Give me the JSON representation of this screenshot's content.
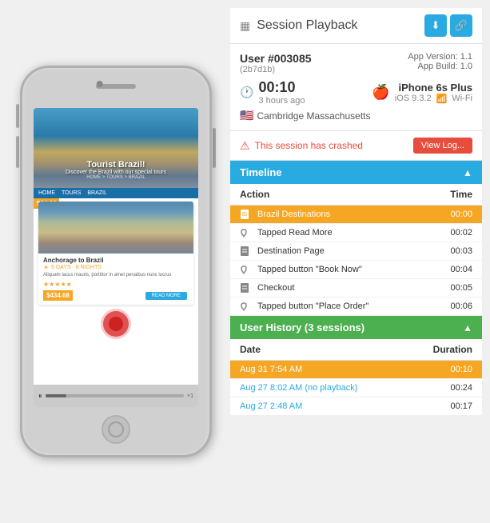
{
  "panel": {
    "title": "Session Playback",
    "download_label": "⬇",
    "share_label": "🔗"
  },
  "user": {
    "id": "User #003085",
    "sub_id": "(2b7d1b)",
    "app_version_label": "App Version: 1.1",
    "app_build_label": "App Build: 1.0",
    "duration": "00:10",
    "time_ago": "3 hours ago",
    "device_name": "iPhone 6s Plus",
    "ios_version": "iOS 9.3.2",
    "wifi": "Wi-Fi",
    "location": "Cambridge Massachusetts"
  },
  "crash": {
    "message": "This session has crashed",
    "view_log_label": "View Log..."
  },
  "timeline": {
    "title": "Timeline",
    "columns": {
      "action": "Action",
      "time": "Time"
    },
    "rows": [
      {
        "icon": "page",
        "action": "Brazil Destinations",
        "time": "00:00",
        "highlighted": true
      },
      {
        "icon": "tap",
        "action": "Tapped Read More",
        "time": "00:02",
        "highlighted": false
      },
      {
        "icon": "page",
        "action": "Destination Page",
        "time": "00:03",
        "highlighted": false
      },
      {
        "icon": "tap",
        "action": "Tapped button \"Book Now\"",
        "time": "00:04",
        "highlighted": false
      },
      {
        "icon": "page",
        "action": "Checkout",
        "time": "00:05",
        "highlighted": false
      },
      {
        "icon": "tap",
        "action": "Tapped button \"Place Order\"",
        "time": "00:06",
        "highlighted": false
      }
    ]
  },
  "user_history": {
    "title": "User History (3 sessions)",
    "columns": {
      "date": "Date",
      "duration": "Duration"
    },
    "rows": [
      {
        "date": "Aug 31 7:54 AM",
        "duration": "00:10",
        "type": "current"
      },
      {
        "date": "Aug 27 8:02 AM (no playback)",
        "duration": "00:24",
        "type": "no-playback"
      },
      {
        "date": "Aug 27 2:48 AM",
        "duration": "00:17",
        "type": "past"
      }
    ]
  },
  "phone": {
    "hero_title": "Tourist Brazil!",
    "hero_subtitle": "Discover the Brazil with our special tours",
    "hero_nav": "HOME > TOURS > BRAZIL",
    "price1": "$64.06",
    "card_title": "Anchorage to Brazil",
    "card_days": "6 DAYS · 8 NIGHTS",
    "card_desc": "Aliquam lacus mauris, porttitor in amet penaibus nunc lucrus",
    "card_price2": "$434.68",
    "read_more_btn": "READ MORE"
  },
  "playback": {
    "zoom_label": "×1"
  }
}
